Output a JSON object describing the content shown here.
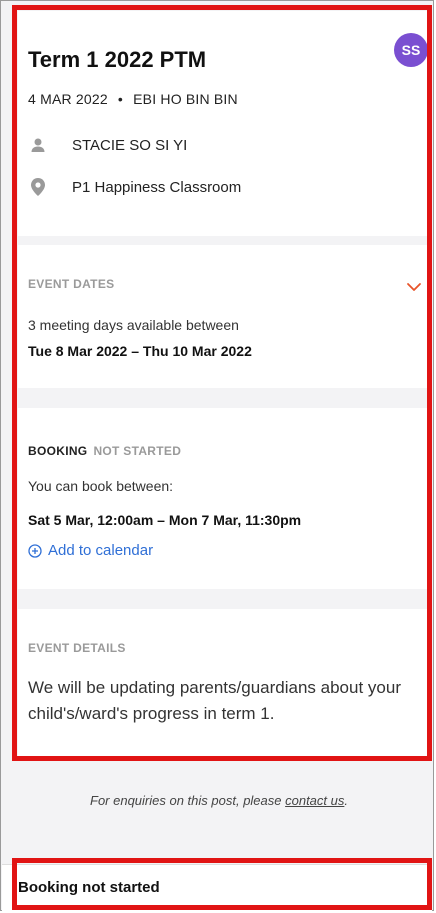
{
  "header": {
    "title": "Term 1 2022 PTM",
    "avatar_initials": "SS",
    "date": "4 MAR 2022",
    "separator": "•",
    "author": "EBI HO BIN BIN",
    "student": "STACIE SO SI YI",
    "location": "P1 Happiness Classroom"
  },
  "event_dates": {
    "label": "EVENT DATES",
    "summary": "3 meeting days available between",
    "range": "Tue 8 Mar 2022 – Thu 10 Mar 2022"
  },
  "booking": {
    "label": "BOOKING",
    "status": "NOT STARTED",
    "intro": "You can book between:",
    "range": "Sat 5 Mar, 12:00am – Mon 7 Mar, 11:30pm",
    "add_to_calendar": "Add to calendar"
  },
  "event_details": {
    "label": "EVENT DETAILS",
    "text": "We will be updating parents/guardians about your child's/ward's progress in term 1."
  },
  "footer": {
    "note_prefix": "For enquiries on this post, please ",
    "contact_link": "contact us",
    "note_suffix": ".",
    "bottom_status": "Booking not started"
  },
  "colors": {
    "accent": "#e8542a",
    "link": "#2f6fd6",
    "avatar": "#7a4fd1",
    "highlight": "#e11414"
  }
}
